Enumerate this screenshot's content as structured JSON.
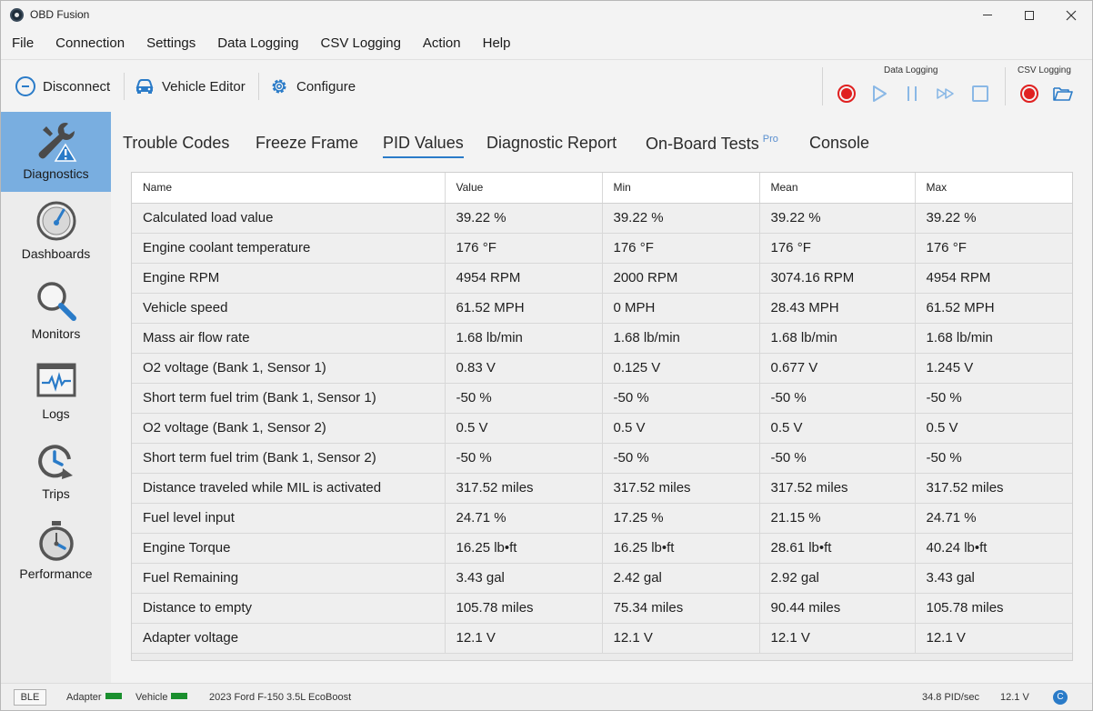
{
  "window": {
    "title": "OBD Fusion"
  },
  "menu": [
    "File",
    "Connection",
    "Settings",
    "Data Logging",
    "CSV Logging",
    "Action",
    "Help"
  ],
  "toolbar": {
    "disconnect_label": "Disconnect",
    "vehicle_editor_label": "Vehicle Editor",
    "configure_label": "Configure",
    "data_logging_label": "Data Logging",
    "csv_logging_label": "CSV Logging"
  },
  "sidebar": {
    "items": [
      {
        "label": "Diagnostics",
        "icon": "wrench-warning-icon",
        "active": true
      },
      {
        "label": "Dashboards",
        "icon": "gauge-icon",
        "active": false
      },
      {
        "label": "Monitors",
        "icon": "magnifier-icon",
        "active": false
      },
      {
        "label": "Logs",
        "icon": "waveform-icon",
        "active": false
      },
      {
        "label": "Trips",
        "icon": "clock-arrow-icon",
        "active": false
      },
      {
        "label": "Performance",
        "icon": "stopwatch-icon",
        "active": false
      }
    ]
  },
  "tabs": [
    {
      "label": "Trouble Codes"
    },
    {
      "label": "Freeze Frame"
    },
    {
      "label": "PID Values",
      "active": true
    },
    {
      "label": "Diagnostic Report"
    },
    {
      "label": "On-Board Tests",
      "badge": "Pro"
    },
    {
      "label": "Console"
    }
  ],
  "table": {
    "columns": [
      "Name",
      "Value",
      "Min",
      "Mean",
      "Max"
    ],
    "rows": [
      [
        "Calculated load value",
        "39.22 %",
        "39.22 %",
        "39.22 %",
        "39.22 %"
      ],
      [
        "Engine coolant temperature",
        "176 °F",
        "176 °F",
        "176 °F",
        "176 °F"
      ],
      [
        "Engine RPM",
        "4954 RPM",
        "2000 RPM",
        "3074.16 RPM",
        "4954 RPM"
      ],
      [
        "Vehicle speed",
        "61.52 MPH",
        "0 MPH",
        "28.43 MPH",
        "61.52 MPH"
      ],
      [
        "Mass air flow rate",
        "1.68 lb/min",
        "1.68 lb/min",
        "1.68 lb/min",
        "1.68 lb/min"
      ],
      [
        "O2 voltage (Bank 1, Sensor 1)",
        "0.83 V",
        "0.125 V",
        "0.677 V",
        "1.245 V"
      ],
      [
        "Short term fuel trim (Bank 1, Sensor 1)",
        "-50 %",
        "-50 %",
        "-50 %",
        "-50 %"
      ],
      [
        "O2 voltage (Bank 1, Sensor 2)",
        "0.5 V",
        "0.5 V",
        "0.5 V",
        "0.5 V"
      ],
      [
        "Short term fuel trim (Bank 1, Sensor 2)",
        "-50 %",
        "-50 %",
        "-50 %",
        "-50 %"
      ],
      [
        "Distance traveled while MIL is activated",
        "317.52 miles",
        "317.52 miles",
        "317.52 miles",
        "317.52 miles"
      ],
      [
        "Fuel level input",
        "24.71 %",
        "17.25 %",
        "21.15 %",
        "24.71 %"
      ],
      [
        "Engine Torque",
        "16.25 lb•ft",
        "16.25 lb•ft",
        "28.61 lb•ft",
        "40.24 lb•ft"
      ],
      [
        "Fuel Remaining",
        "3.43 gal",
        "2.42 gal",
        "2.92 gal",
        "3.43 gal"
      ],
      [
        "Distance to empty",
        "105.78 miles",
        "75.34 miles",
        "90.44 miles",
        "105.78 miles"
      ],
      [
        "Adapter voltage",
        "12.1 V",
        "12.1 V",
        "12.1 V",
        "12.1 V"
      ]
    ]
  },
  "status": {
    "connection_type": "BLE",
    "adapter_label": "Adapter",
    "vehicle_label": "Vehicle",
    "vehicle_name": "2023 Ford F-150 3.5L EcoBoost",
    "pid_rate": "34.8 PID/sec",
    "voltage": "12.1 V",
    "badge": "C",
    "ok_color": "#1a8f2e"
  },
  "colors": {
    "accent": "#2a7bc8",
    "record": "#e02020",
    "sidebar_active": "#79aee0"
  }
}
